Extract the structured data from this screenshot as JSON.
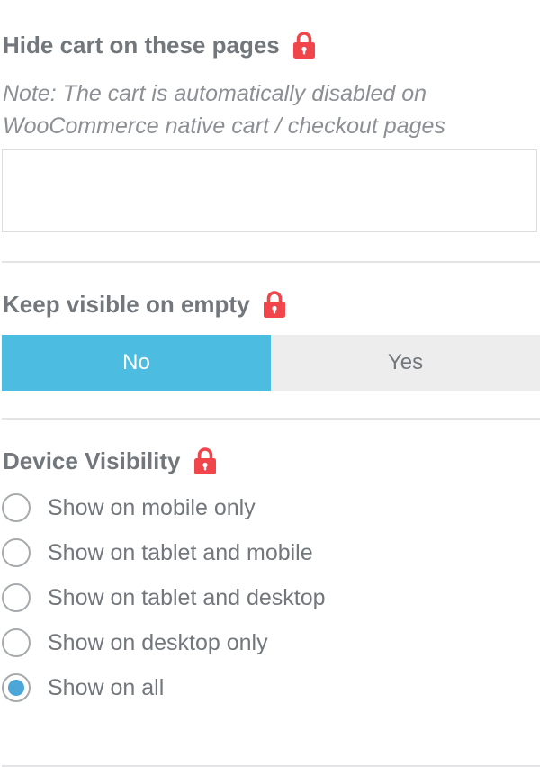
{
  "hide_cart": {
    "title": "Hide cart on these pages",
    "note": "Note: The cart is automatically disabled on WooCommerce native cart / checkout pages",
    "pages_value": ""
  },
  "keep_visible": {
    "title": "Keep visible on empty",
    "options": [
      "No",
      "Yes"
    ],
    "selected": "No"
  },
  "device_visibility": {
    "title": "Device Visibility",
    "options": [
      "Show on mobile only",
      "Show on tablet and mobile",
      "Show on tablet and desktop",
      "Show on desktop only",
      "Show on all"
    ],
    "selected": "Show on all"
  },
  "colors": {
    "accent": "#4cbde0",
    "radio_selected": "#4ca6d8",
    "lock": "#f0464b",
    "text": "#72777c"
  },
  "icons": {
    "pro_lock": "lock-icon"
  }
}
